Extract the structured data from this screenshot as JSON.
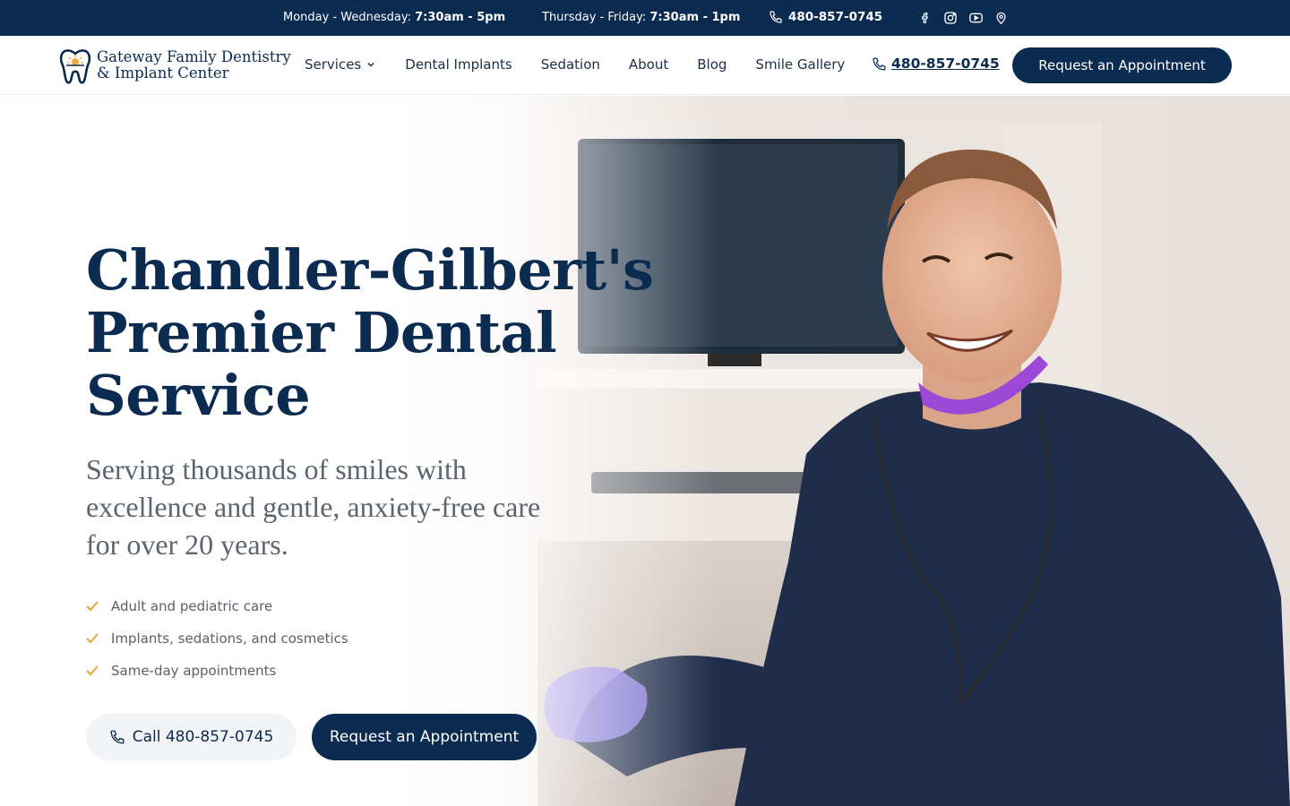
{
  "topbar": {
    "hours_mw_label": "Monday - Wednesday:",
    "hours_mw_time": "7:30am - 5pm",
    "hours_tf_label": "Thursday - Friday:",
    "hours_tf_time": "7:30am - 1pm",
    "phone": "480-857-0745",
    "socials": [
      "facebook-icon",
      "instagram-icon",
      "youtube-icon",
      "map-pin-icon"
    ]
  },
  "brand": {
    "line1": "Gateway Family Dentistry",
    "line2": "& Implant Center"
  },
  "nav": {
    "items": [
      "Services",
      "Dental Implants",
      "Sedation",
      "About",
      "Blog",
      "Smile Gallery"
    ],
    "phone": "480-857-0745",
    "cta": "Request an Appointment"
  },
  "hero": {
    "headline_1": "Chandler-Gilbert's",
    "headline_2": "Premier Dental",
    "headline_3": "Service",
    "subline": "Serving thousands of smiles with excellence and gentle, anxiety-free care for over 20 years.",
    "checks": [
      "Adult and pediatric care",
      "Implants, sedations, and cosmetics",
      "Same-day appointments"
    ],
    "call_button": "Call 480-857-0745",
    "appt_button": "Request an Appointment"
  },
  "colors": {
    "navy": "#0b2b50",
    "accent_check": "#e8a13a",
    "scrub_purple": "#9b49d6"
  }
}
